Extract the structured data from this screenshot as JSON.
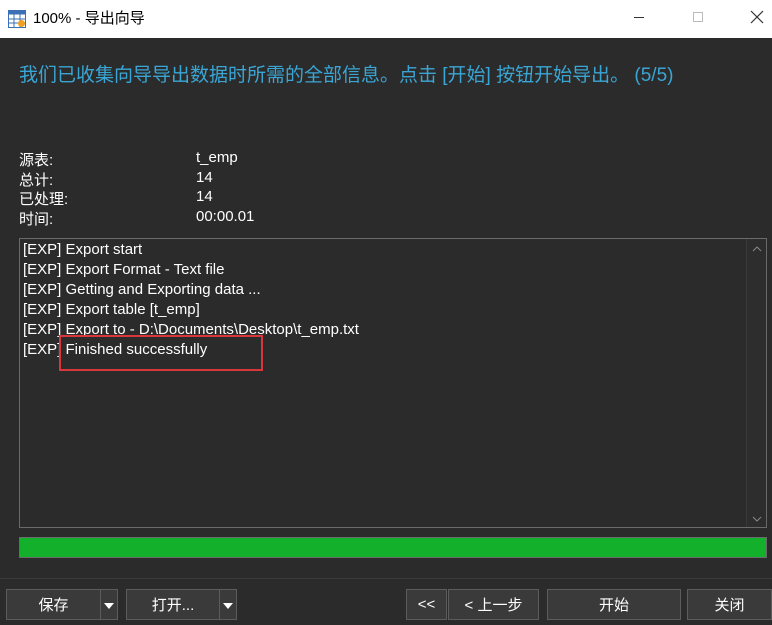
{
  "window": {
    "title": "100% - 导出向导"
  },
  "heading": "我们已收集向导导出数据时所需的全部信息。点击 [开始] 按钮开始导出。 (5/5)",
  "info": {
    "source_label": "源表:",
    "source_value": "t_emp",
    "total_label": "总计:",
    "total_value": "14",
    "processed_label": "已处理:",
    "processed_value": "14",
    "time_label": "时间:",
    "time_value": "00:00.01"
  },
  "log": [
    "[EXP] Export start",
    "[EXP] Export Format - Text file",
    "[EXP] Getting and Exporting data ...",
    "[EXP] Export table [t_emp]",
    "[EXP] Export to - D:\\Documents\\Desktop\\t_emp.txt",
    "[EXP] Finished successfully"
  ],
  "progress": {
    "percent": 100,
    "color": "#13b02b"
  },
  "buttons": {
    "save": "保存",
    "open": "打开...",
    "first": "<<",
    "prev": "< 上一步",
    "start": "开始",
    "close": "关闭"
  },
  "colors": {
    "heading": "#3aa6d6",
    "highlight": "#d9363e"
  },
  "icons": [
    "app-table-icon",
    "minimize-icon",
    "maximize-icon",
    "close-icon",
    "scroll-up-icon",
    "scroll-down-icon",
    "dropdown-arrow-icon"
  ]
}
